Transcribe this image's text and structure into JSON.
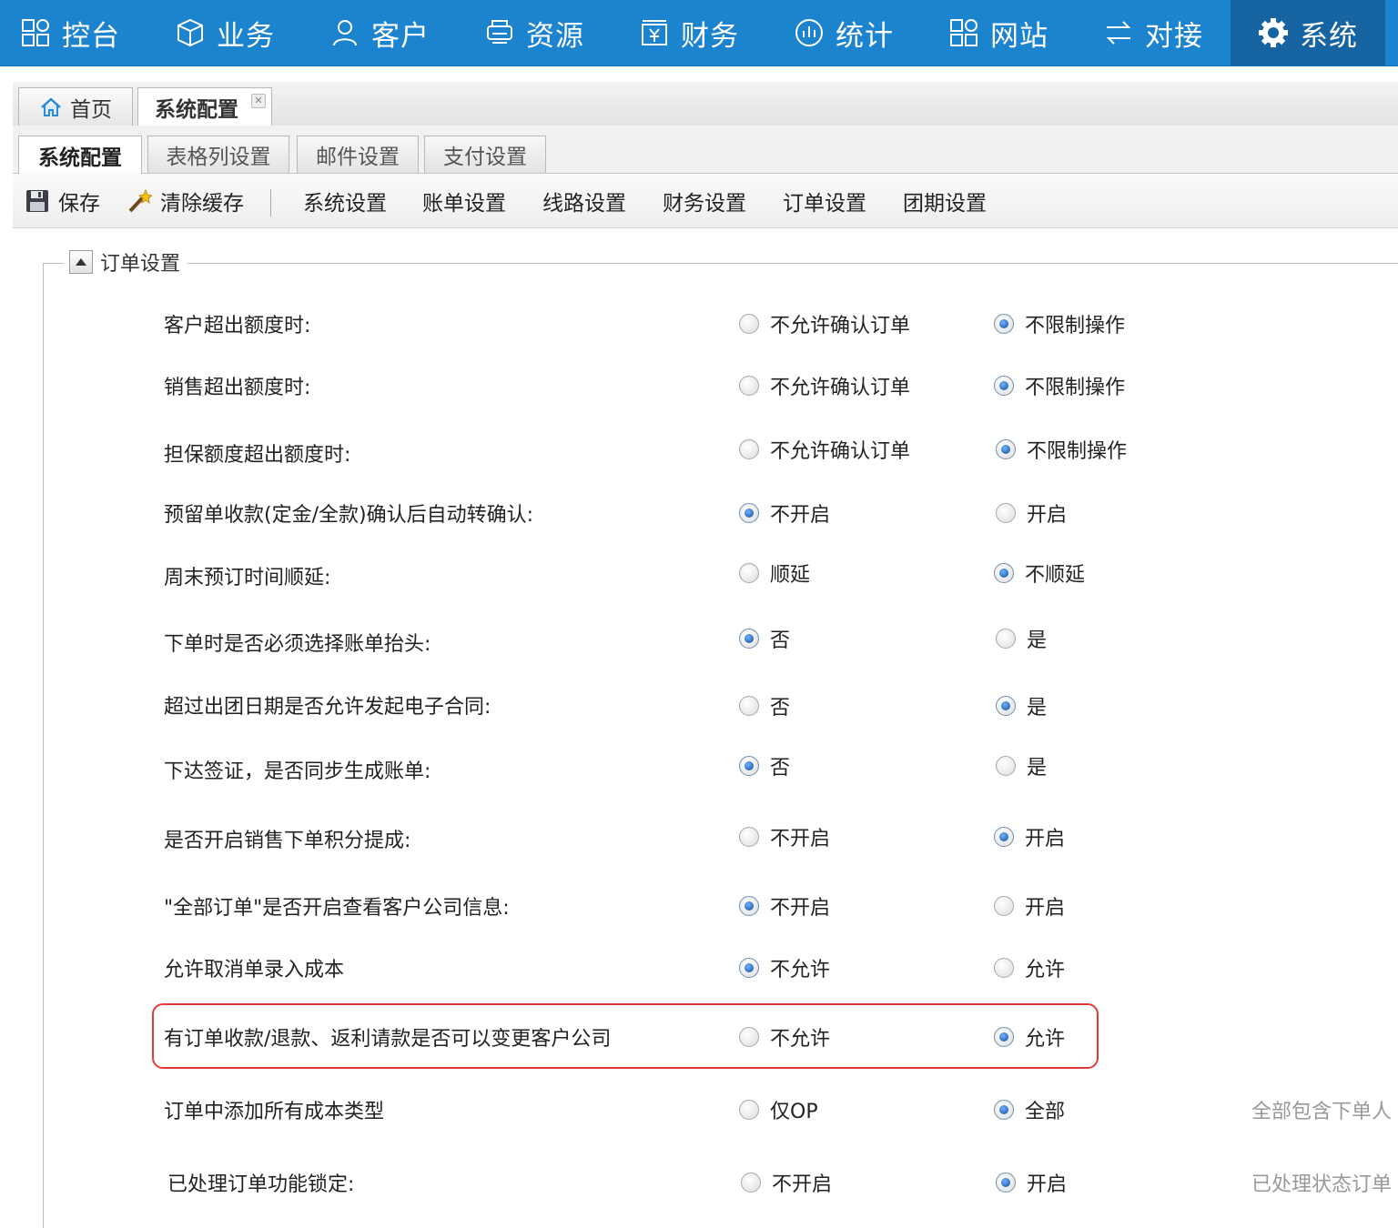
{
  "nav": [
    {
      "label": "控台",
      "icon": "dashboard-icon"
    },
    {
      "label": "业务",
      "icon": "cube-icon"
    },
    {
      "label": "客户",
      "icon": "user-icon"
    },
    {
      "label": "资源",
      "icon": "printer-icon"
    },
    {
      "label": "财务",
      "icon": "yen-box-icon"
    },
    {
      "label": "统计",
      "icon": "stats-icon"
    },
    {
      "label": "网站",
      "icon": "grid-icon"
    },
    {
      "label": "对接",
      "icon": "exchange-icon"
    },
    {
      "label": "系统",
      "icon": "gear-icon",
      "active": true
    }
  ],
  "page_tabs": [
    {
      "label": "首页",
      "icon": "home-icon"
    },
    {
      "label": "系统配置",
      "closable": true,
      "active": true
    }
  ],
  "sub_tabs": [
    {
      "label": "系统配置",
      "active": true
    },
    {
      "label": "表格列设置"
    },
    {
      "label": "邮件设置"
    },
    {
      "label": "支付设置"
    }
  ],
  "toolbar": {
    "save": "保存",
    "clear_cache": "清除缓存",
    "links": [
      "系统设置",
      "账单设置",
      "线路设置",
      "财务设置",
      "订单设置",
      "团期设置"
    ]
  },
  "section": {
    "title": "订单设置"
  },
  "settings": [
    {
      "label": "客户超出额度时:",
      "options": [
        "不允许确认订单",
        "不限制操作"
      ],
      "selected": 1
    },
    {
      "label": "销售超出额度时:",
      "options": [
        "不允许确认订单",
        "不限制操作"
      ],
      "selected": 1
    },
    {
      "label": "担保额度超出额度时:",
      "options": [
        "不允许确认订单",
        "不限制操作"
      ],
      "selected": 1
    },
    {
      "label": "预留单收款(定金/全款)确认后自动转确认:",
      "options": [
        "不开启",
        "开启"
      ],
      "selected": 0
    },
    {
      "label": "周末预订时间顺延:",
      "options": [
        "顺延",
        "不顺延"
      ],
      "selected": 1
    },
    {
      "label": "下单时是否必须选择账单抬头:",
      "options": [
        "否",
        "是"
      ],
      "selected": 0
    },
    {
      "label": "超过出团日期是否允许发起电子合同:",
      "options": [
        "否",
        "是"
      ],
      "selected": 1
    },
    {
      "label": "下达签证，是否同步生成账单:",
      "options": [
        "否",
        "是"
      ],
      "selected": 0
    },
    {
      "label": "是否开启销售下单积分提成:",
      "options": [
        "不开启",
        "开启"
      ],
      "selected": 1
    },
    {
      "label": "\"全部订单\"是否开启查看客户公司信息:",
      "options": [
        "不开启",
        "开启"
      ],
      "selected": 0
    },
    {
      "label": "允许取消单录入成本",
      "options": [
        "不允许",
        "允许"
      ],
      "selected": 0
    },
    {
      "label": "有订单收款/退款、返利请款是否可以变更客户公司",
      "options": [
        "不允许",
        "允许"
      ],
      "selected": 1,
      "highlighted": true
    },
    {
      "label": "订单中添加所有成本类型",
      "options": [
        "仅OP",
        "全部"
      ],
      "selected": 1,
      "note": "全部包含下单人"
    },
    {
      "label": "已处理订单功能锁定:",
      "options": [
        "不开启",
        "开启"
      ],
      "selected": 1,
      "note": "已处理状态订单"
    }
  ],
  "colors": {
    "nav_bg": "#1c83cf",
    "nav_active": "#1664a2",
    "highlight": "#e23a3a"
  }
}
